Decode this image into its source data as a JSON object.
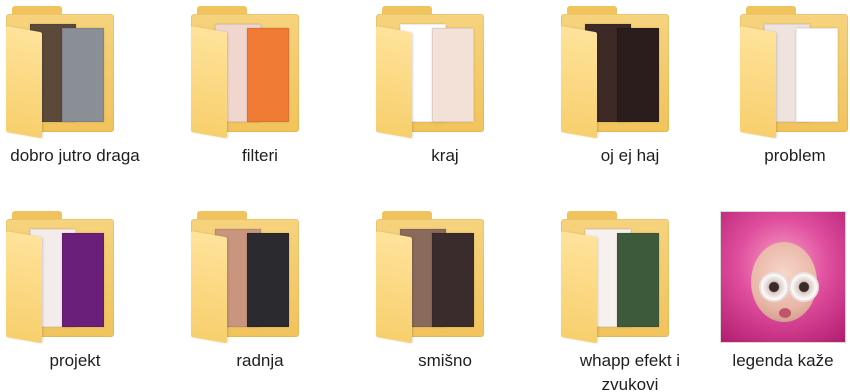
{
  "folders": [
    {
      "label": "dobro jutro draga",
      "icon": "folder-icon",
      "page_colors": [
        "#5b4a3a",
        "#8a8f95"
      ]
    },
    {
      "label": "filteri",
      "icon": "folder-icon",
      "page_colors": [
        "#f0d6cc",
        "#ef7b35"
      ]
    },
    {
      "label": "kraj",
      "icon": "folder-icon",
      "page_colors": [
        "#ffffff",
        "#f3e1d8"
      ]
    },
    {
      "label": "oj ej haj",
      "icon": "folder-icon",
      "page_colors": [
        "#3d2a26",
        "#2a1d1c"
      ]
    },
    {
      "label": "problem",
      "icon": "folder-icon",
      "page_colors": [
        "#efe3de",
        "#ffffff"
      ]
    },
    {
      "label": "projekt",
      "icon": "folder-icon",
      "page_colors": [
        "#f4ecea",
        "#6a1f7a"
      ]
    },
    {
      "label": "radnja",
      "icon": "folder-icon",
      "page_colors": [
        "#c9957f",
        "#2b2b2f"
      ]
    },
    {
      "label": "smišno",
      "icon": "folder-icon",
      "page_colors": [
        "#8a6a5a",
        "#3a2c2c"
      ]
    },
    {
      "label": "whapp efekt i zvukovi",
      "icon": "folder-icon",
      "page_colors": [
        "#f6f1ee",
        "#3d5a3a"
      ]
    }
  ],
  "image_file": {
    "label": "legenda kaže",
    "icon": "image-thumbnail",
    "accent_color": "#e04e9e"
  }
}
